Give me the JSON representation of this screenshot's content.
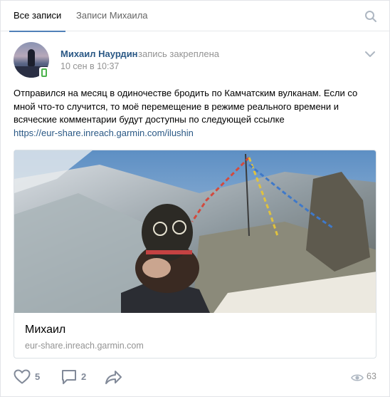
{
  "tabs": [
    {
      "label": "Все записи",
      "active": true
    },
    {
      "label": "Записи Михаила",
      "active": false
    }
  ],
  "post": {
    "author": "Михаил Наурдин",
    "pinned_label": "запись закреплена",
    "date": "10 сен в 10:37",
    "text": "Отправился на месяц в одиночестве бродить по Камчатским вулканам. Если со мной что-то случится, то моё перемещение в режиме реального времени и всяческие комментарии будут доступны по следующей ссылке",
    "link": "https://eur-share.inreach.garmin.com/ilushin"
  },
  "snippet": {
    "title": "Михаил",
    "domain": "eur-share.inreach.garmin.com"
  },
  "actions": {
    "likes": "5",
    "comments": "2",
    "views": "63"
  },
  "colors": {
    "link": "#2a5885",
    "accent": "#5181b8",
    "muted": "#939393",
    "online": "#4bb34b",
    "icon": "#828a99"
  },
  "icons": [
    "search-icon",
    "chevron-down-icon",
    "mobile-online-icon",
    "heart-icon",
    "comment-icon",
    "share-arrow-icon",
    "eye-icon"
  ]
}
